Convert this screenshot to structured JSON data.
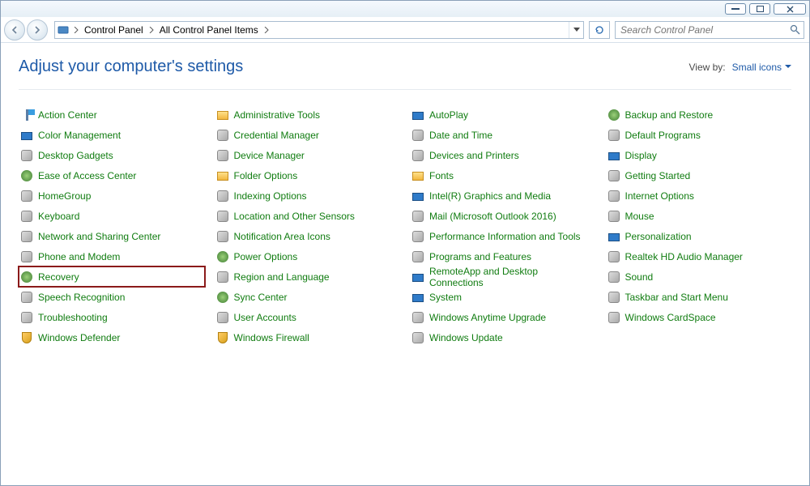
{
  "breadcrumbs": [
    "Control Panel",
    "All Control Panel Items"
  ],
  "search": {
    "placeholder": "Search Control Panel"
  },
  "header": {
    "title": "Adjust your computer's settings",
    "viewby_label": "View by:",
    "viewby_value": "Small icons"
  },
  "highlighted": "Recovery",
  "columns": [
    [
      {
        "label": "Action Center",
        "icon": "flag-icon"
      },
      {
        "label": "Color Management",
        "icon": "display-icon"
      },
      {
        "label": "Desktop Gadgets",
        "icon": "misc-icon"
      },
      {
        "label": "Ease of Access Center",
        "icon": "gear-icon"
      },
      {
        "label": "HomeGroup",
        "icon": "misc-icon"
      },
      {
        "label": "Keyboard",
        "icon": "misc-icon"
      },
      {
        "label": "Network and Sharing Center",
        "icon": "misc-icon"
      },
      {
        "label": "Phone and Modem",
        "icon": "misc-icon"
      },
      {
        "label": "Recovery",
        "icon": "gear-icon"
      },
      {
        "label": "Speech Recognition",
        "icon": "misc-icon"
      },
      {
        "label": "Troubleshooting",
        "icon": "misc-icon"
      },
      {
        "label": "Windows Defender",
        "icon": "shield-icon"
      }
    ],
    [
      {
        "label": "Administrative Tools",
        "icon": "folder-icon"
      },
      {
        "label": "Credential Manager",
        "icon": "misc-icon"
      },
      {
        "label": "Device Manager",
        "icon": "misc-icon"
      },
      {
        "label": "Folder Options",
        "icon": "folder-icon"
      },
      {
        "label": "Indexing Options",
        "icon": "misc-icon"
      },
      {
        "label": "Location and Other Sensors",
        "icon": "misc-icon"
      },
      {
        "label": "Notification Area Icons",
        "icon": "misc-icon"
      },
      {
        "label": "Power Options",
        "icon": "gear-icon"
      },
      {
        "label": "Region and Language",
        "icon": "misc-icon"
      },
      {
        "label": "Sync Center",
        "icon": "gear-icon"
      },
      {
        "label": "User Accounts",
        "icon": "misc-icon"
      },
      {
        "label": "Windows Firewall",
        "icon": "shield-icon"
      }
    ],
    [
      {
        "label": "AutoPlay",
        "icon": "display-icon"
      },
      {
        "label": "Date and Time",
        "icon": "misc-icon"
      },
      {
        "label": "Devices and Printers",
        "icon": "misc-icon"
      },
      {
        "label": "Fonts",
        "icon": "folder-icon"
      },
      {
        "label": "Intel(R) Graphics and Media",
        "icon": "display-icon"
      },
      {
        "label": "Mail (Microsoft Outlook 2016)",
        "icon": "misc-icon"
      },
      {
        "label": "Performance Information and Tools",
        "icon": "misc-icon"
      },
      {
        "label": "Programs and Features",
        "icon": "misc-icon"
      },
      {
        "label": "RemoteApp and Desktop Connections",
        "icon": "display-icon"
      },
      {
        "label": "System",
        "icon": "display-icon"
      },
      {
        "label": "Windows Anytime Upgrade",
        "icon": "misc-icon"
      },
      {
        "label": "Windows Update",
        "icon": "misc-icon"
      }
    ],
    [
      {
        "label": "Backup and Restore",
        "icon": "gear-icon"
      },
      {
        "label": "Default Programs",
        "icon": "misc-icon"
      },
      {
        "label": "Display",
        "icon": "display-icon"
      },
      {
        "label": "Getting Started",
        "icon": "misc-icon"
      },
      {
        "label": "Internet Options",
        "icon": "misc-icon"
      },
      {
        "label": "Mouse",
        "icon": "misc-icon"
      },
      {
        "label": "Personalization",
        "icon": "display-icon"
      },
      {
        "label": "Realtek HD Audio Manager",
        "icon": "misc-icon"
      },
      {
        "label": "Sound",
        "icon": "misc-icon"
      },
      {
        "label": "Taskbar and Start Menu",
        "icon": "misc-icon"
      },
      {
        "label": "Windows CardSpace",
        "icon": "misc-icon"
      }
    ]
  ]
}
